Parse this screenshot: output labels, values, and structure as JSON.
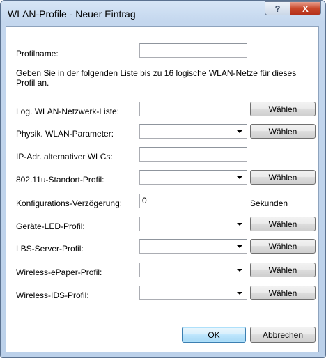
{
  "window": {
    "title": "WLAN-Profile - Neuer Eintrag",
    "help_glyph": "?",
    "close_glyph": "X"
  },
  "form": {
    "profilename_label": "Profilname:",
    "profilename_value": "",
    "description": "Geben Sie in der folgenden Liste bis zu 16 logische WLAN-Netze für dieses Profil an.",
    "log_wlan_label": "Log. WLAN-Netzwerk-Liste:",
    "log_wlan_value": "",
    "physik_label": "Physik. WLAN-Parameter:",
    "physik_value": "",
    "ip_adr_label": "IP-Adr. alternativer WLCs:",
    "ip_adr_value": "",
    "standort_label": "802.11u-Standort-Profil:",
    "standort_value": "",
    "verzoegerung_label": "Konfigurations-Verzögerung:",
    "verzoegerung_value": "0",
    "verzoegerung_unit": "Sekunden",
    "led_label": "Geräte-LED-Profil:",
    "led_value": "",
    "lbs_label": "LBS-Server-Profil:",
    "lbs_value": "",
    "epaper_label": "Wireless-ePaper-Profil:",
    "epaper_value": "",
    "ids_label": "Wireless-IDS-Profil:",
    "ids_value": ""
  },
  "buttons": {
    "select": "Wählen",
    "ok": "OK",
    "cancel": "Abbrechen"
  },
  "icons": {
    "dropdown": "chevron-down-icon"
  }
}
